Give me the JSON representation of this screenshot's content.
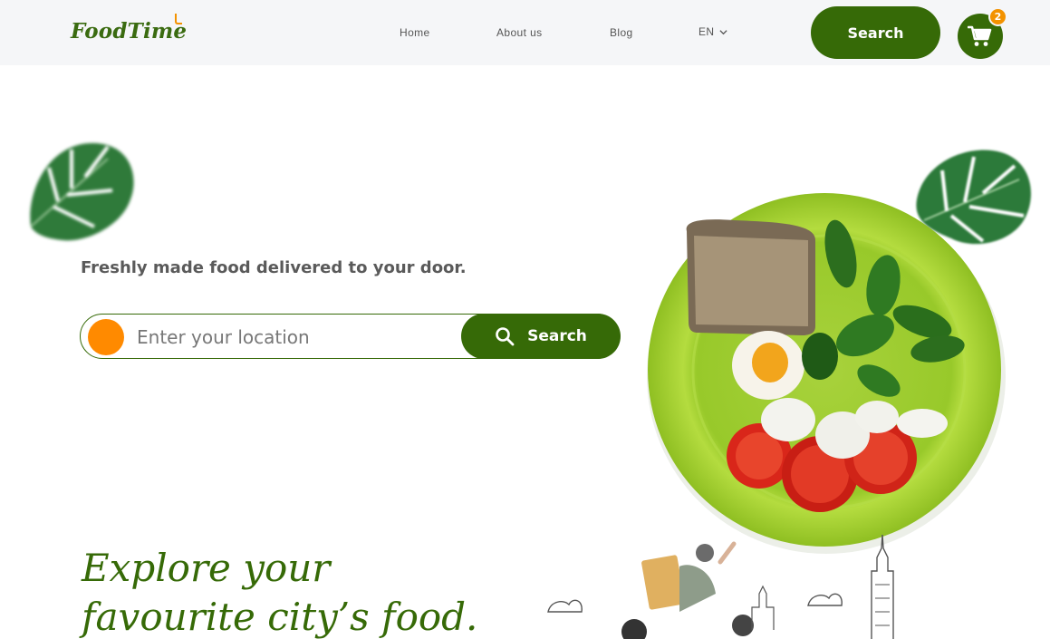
{
  "header": {
    "logo_text": "FoodTime",
    "nav": [
      {
        "label": "Home"
      },
      {
        "label": "About us"
      },
      {
        "label": "Blog"
      },
      {
        "label": "EN"
      }
    ],
    "search_label": "Search",
    "cart_count": "2"
  },
  "hero": {
    "tagline": "Freshly made food delivered to your door.",
    "location_placeholder": "Enter your location",
    "search_label": "Search",
    "headline_line1": "Explore your",
    "headline_line2": "favourite city’s food."
  },
  "colors": {
    "brand_green": "#366a07",
    "accent_orange": "#f39200",
    "header_bg": "#f5f6f8"
  },
  "icons": [
    "chevron-down-icon",
    "cart-icon",
    "search-icon",
    "location-dot-icon",
    "leaf-icon"
  ]
}
